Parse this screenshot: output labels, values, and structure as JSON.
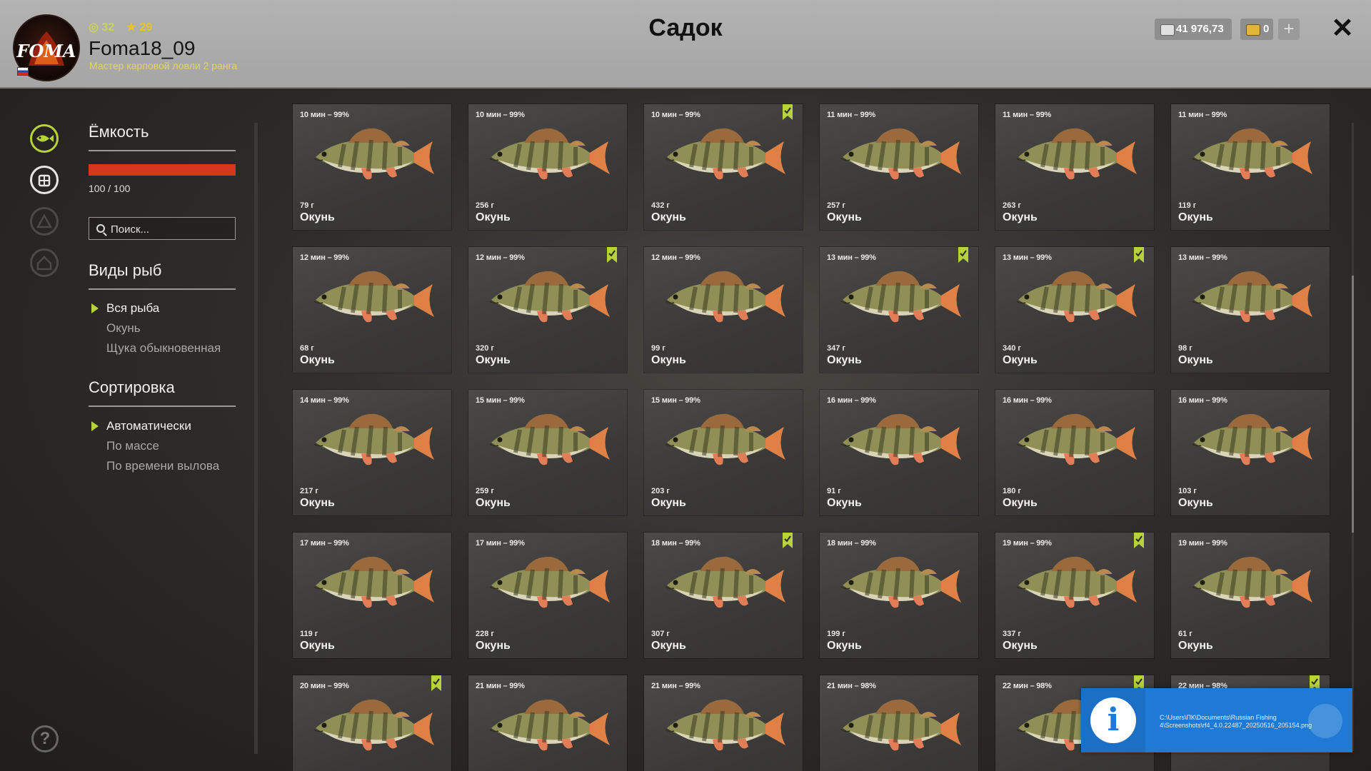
{
  "header": {
    "title": "Садок",
    "user": {
      "level": "32",
      "rank": "29",
      "name": "Foma18_09",
      "title": "Мастер карповой ловли 2 ранга"
    },
    "currency": {
      "silver": "41 976,73",
      "gold": "0"
    },
    "plus_label": "+",
    "close_label": "✕"
  },
  "sidebar": {
    "capacity_title": "Ёмкость",
    "capacity_text": "100 / 100",
    "capacity_fill": 1.0,
    "search_placeholder": "Поиск...",
    "species_title": "Виды рыб",
    "species": [
      "Вся рыба",
      "Окунь",
      "Щука обыкновенная"
    ],
    "sort_title": "Сортировка",
    "sort": [
      "Автоматически",
      "По массе",
      "По времени вылова"
    ],
    "help_label": "?"
  },
  "grid": {
    "cards": [
      {
        "time": "10 мин – 99%",
        "weight": "79 г",
        "name": "Окунь",
        "marked": false
      },
      {
        "time": "10 мин – 99%",
        "weight": "256 г",
        "name": "Окунь",
        "marked": false
      },
      {
        "time": "10 мин – 99%",
        "weight": "432 г",
        "name": "Окунь",
        "marked": true
      },
      {
        "time": "11 мин – 99%",
        "weight": "257 г",
        "name": "Окунь",
        "marked": false
      },
      {
        "time": "11 мин – 99%",
        "weight": "263 г",
        "name": "Окунь",
        "marked": false
      },
      {
        "time": "11 мин – 99%",
        "weight": "119 г",
        "name": "Окунь",
        "marked": false
      },
      {
        "time": "12 мин – 99%",
        "weight": "68 г",
        "name": "Окунь",
        "marked": false
      },
      {
        "time": "12 мин – 99%",
        "weight": "320 г",
        "name": "Окунь",
        "marked": true
      },
      {
        "time": "12 мин – 99%",
        "weight": "99 г",
        "name": "Окунь",
        "marked": false
      },
      {
        "time": "13 мин – 99%",
        "weight": "347 г",
        "name": "Окунь",
        "marked": true
      },
      {
        "time": "13 мин – 99%",
        "weight": "340 г",
        "name": "Окунь",
        "marked": true
      },
      {
        "time": "13 мин – 99%",
        "weight": "98 г",
        "name": "Окунь",
        "marked": false
      },
      {
        "time": "14 мин – 99%",
        "weight": "217 г",
        "name": "Окунь",
        "marked": false
      },
      {
        "time": "15 мин – 99%",
        "weight": "259 г",
        "name": "Окунь",
        "marked": false
      },
      {
        "time": "15 мин – 99%",
        "weight": "203 г",
        "name": "Окунь",
        "marked": false
      },
      {
        "time": "16 мин – 99%",
        "weight": "91 г",
        "name": "Окунь",
        "marked": false
      },
      {
        "time": "16 мин – 99%",
        "weight": "180 г",
        "name": "Окунь",
        "marked": false
      },
      {
        "time": "16 мин – 99%",
        "weight": "103 г",
        "name": "Окунь",
        "marked": false
      },
      {
        "time": "17 мин – 99%",
        "weight": "119 г",
        "name": "Окунь",
        "marked": false
      },
      {
        "time": "17 мин – 99%",
        "weight": "228 г",
        "name": "Окунь",
        "marked": false
      },
      {
        "time": "18 мин – 99%",
        "weight": "307 г",
        "name": "Окунь",
        "marked": true
      },
      {
        "time": "18 мин – 99%",
        "weight": "199 г",
        "name": "Окунь",
        "marked": false
      },
      {
        "time": "19 мин – 99%",
        "weight": "337 г",
        "name": "Окунь",
        "marked": true
      },
      {
        "time": "19 мин – 99%",
        "weight": "61 г",
        "name": "Окунь",
        "marked": false
      },
      {
        "time": "20 мин – 99%",
        "weight": "",
        "name": "",
        "marked": true
      },
      {
        "time": "21 мин – 99%",
        "weight": "",
        "name": "",
        "marked": false
      },
      {
        "time": "21 мин – 99%",
        "weight": "",
        "name": "",
        "marked": false
      },
      {
        "time": "21 мин – 98%",
        "weight": "",
        "name": "",
        "marked": false
      },
      {
        "time": "22 мин – 98%",
        "weight": "",
        "name": "",
        "marked": true
      },
      {
        "time": "22 мин – 98%",
        "weight": "",
        "name": "",
        "marked": true
      }
    ]
  },
  "notification": {
    "icon": "info-icon",
    "path": "C:\\Users\\ПК\\Documents\\Russian Fishing 4\\Screenshots\\rf4_4.0.22487_20250516_205154.png"
  },
  "colors": {
    "accent": "#b7d23a",
    "capacity_bar": "#d5371e",
    "bookmark": "#b7d23a",
    "notification": "#1f7ad6"
  }
}
